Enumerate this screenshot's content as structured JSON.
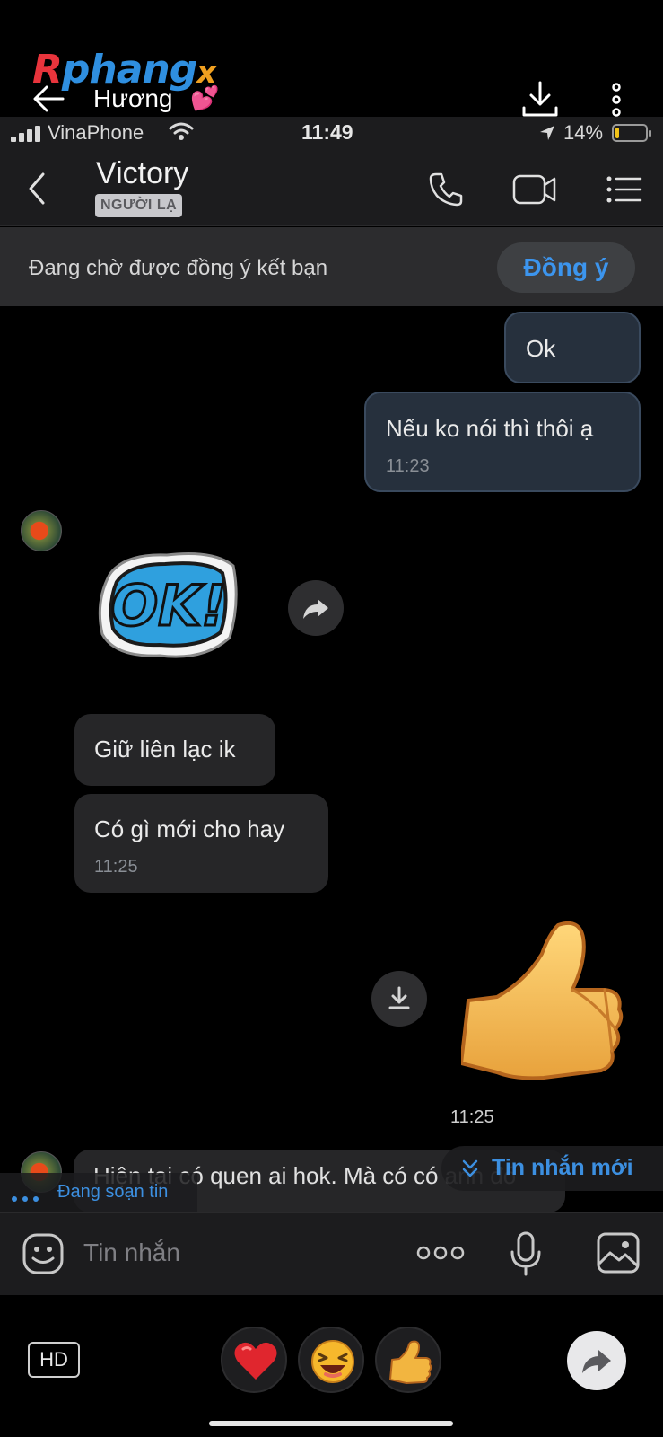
{
  "viewer": {
    "watermark": {
      "part1": "R",
      "part2": "phang",
      "part3": "x"
    },
    "title": "Hương",
    "heart": "💕",
    "back_icon": "arrow-left-icon",
    "download_icon": "download-icon",
    "more_icon": "more-vertical-icon"
  },
  "status_bar": {
    "carrier": "VinaPhone",
    "time": "11:49",
    "battery_percent": "14%",
    "battery_level": 0.14,
    "battery_color": "#f2c318"
  },
  "header": {
    "contact_name": "Victory",
    "badge": "NGƯỜI LẠ",
    "icons": [
      "chevron-left-icon",
      "phone-icon",
      "video-call-icon",
      "menu-list-icon"
    ]
  },
  "pending": {
    "text": "Đang chờ được đồng ý kết bạn",
    "button_label": "Đồng ý",
    "accent": "#3c95ee"
  },
  "messages": [
    {
      "direction": "out",
      "text": "Ok"
    },
    {
      "direction": "out",
      "text": "Nếu ko nói thì thôi ạ",
      "time": "11:23"
    },
    {
      "direction": "in",
      "type": "sticker",
      "sticker": "ok-sticker",
      "sticker_text": "OK!"
    },
    {
      "direction": "in",
      "text": "Giữ liên lạc ik"
    },
    {
      "direction": "in",
      "text": "Có gì mới cho hay",
      "time": "11:25"
    },
    {
      "direction": "out",
      "type": "sticker",
      "sticker": "thumbs-up-sticker",
      "time": "11:25"
    },
    {
      "direction": "in",
      "text": "Hiện tại có quen ai hok. Mà có có anh đó"
    }
  ],
  "typing_indicator": "Đang soạn tin",
  "new_message_pill": "Tin nhắn mới",
  "input": {
    "placeholder": "Tin nhắn",
    "icons": [
      "emoji-icon",
      "more-horizontal-icon",
      "microphone-icon",
      "image-icon"
    ]
  },
  "bottom": {
    "hd_label": "HD",
    "reactions": [
      "❤️",
      "😆",
      "👍"
    ],
    "share_icon": "share-icon"
  },
  "colors": {
    "background": "#000000",
    "bar": "#1c1c1e",
    "accent": "#3c8fe0",
    "outgoing_bubble": "#26303d",
    "incoming_bubble": "#262628"
  }
}
